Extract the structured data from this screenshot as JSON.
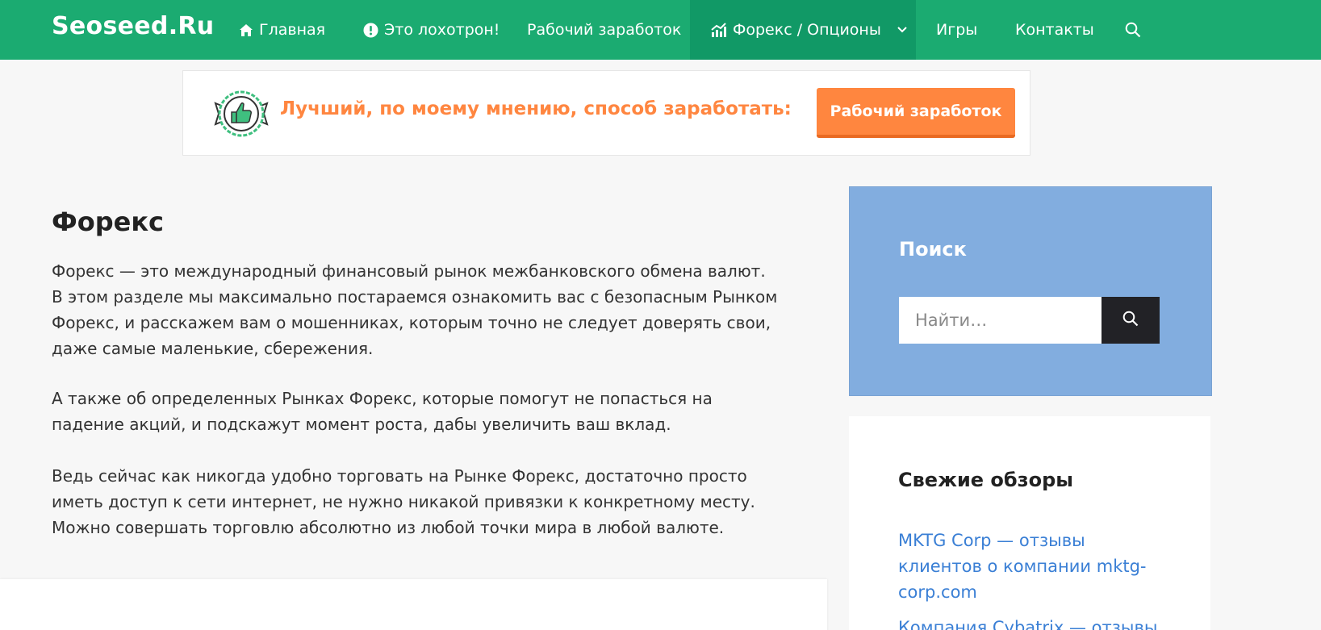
{
  "header": {
    "logo": "Seoseed.Ru",
    "nav": [
      {
        "label": "Главная",
        "icon": "home-icon"
      },
      {
        "label": "Это лохотрон!",
        "icon": "exclamation-circle-icon"
      },
      {
        "label": "Рабочий заработок"
      },
      {
        "label": "Форекс / Опционы",
        "icon": "chart-icon",
        "dropdown": true,
        "active": true
      },
      {
        "label": "Игры"
      },
      {
        "label": "Контакты"
      }
    ],
    "search_icon": "search-icon"
  },
  "banner": {
    "badge_icon": "thumbs-up-badge-icon",
    "text": "Лучший, по моему мнению, способ заработать:",
    "button_label": "Рабочий заработок"
  },
  "main": {
    "title": "Форекс",
    "paragraphs": [
      "Форекс — это международный финансовый рынок межбанковского обмена валют. В этом разделе мы максимально постараемся ознакомить вас с безопасным Рынком Форекс, и расскажем вам о мошенниках, которым точно не следует доверять свои, даже самые маленькие, сбережения.",
      "А также об определенных Рынках Форекс, которые помогут не попасться на падение акций, и подскажут момент роста, дабы увеличить ваш вклад.",
      "Ведь сейчас как никогда удобно торговать на Рынке Форекс, достаточно просто иметь доступ к сети интернет, не нужно никакой привязки к конкретному месту. Можно совершать торговлю абсолютно из любой точки мира в любой валюте."
    ]
  },
  "sidebar": {
    "search": {
      "title": "Поиск",
      "placeholder": "Найти…"
    },
    "reviews": {
      "title": "Свежие обзоры",
      "items": [
        "MKTG Corp — отзывы клиентов о компании mktg-corp.com",
        "Компания Cybatrix — отзывы"
      ]
    }
  },
  "colors": {
    "header_bg": "#1bab71",
    "header_active": "#119966",
    "accent_orange": "#ff8640",
    "search_widget_bg": "#82addf",
    "link": "#3a7fd5"
  }
}
